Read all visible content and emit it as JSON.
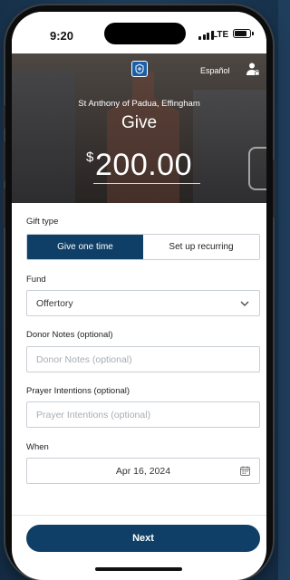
{
  "status_bar": {
    "time": "9:20",
    "network": "LTE"
  },
  "header": {
    "language_link": "Español",
    "parish_name": "St Anthony of Padua, Effingham",
    "title": "Give",
    "currency_symbol": "$",
    "amount": "200.00"
  },
  "gift_type": {
    "label": "Gift type",
    "options": [
      "Give one time",
      "Set up recurring"
    ],
    "selected": "Give one time"
  },
  "fund": {
    "label": "Fund",
    "value": "Offertory"
  },
  "donor_notes": {
    "label": "Donor Notes (optional)",
    "placeholder": "Donor Notes (optional)"
  },
  "prayer_intentions": {
    "label": "Prayer Intentions (optional)",
    "placeholder": "Prayer Intentions (optional)"
  },
  "when": {
    "label": "When",
    "value": "Apr 16, 2024"
  },
  "actions": {
    "next_label": "Next"
  },
  "colors": {
    "primary": "#0f3f66",
    "background": "#1f3e5c"
  }
}
